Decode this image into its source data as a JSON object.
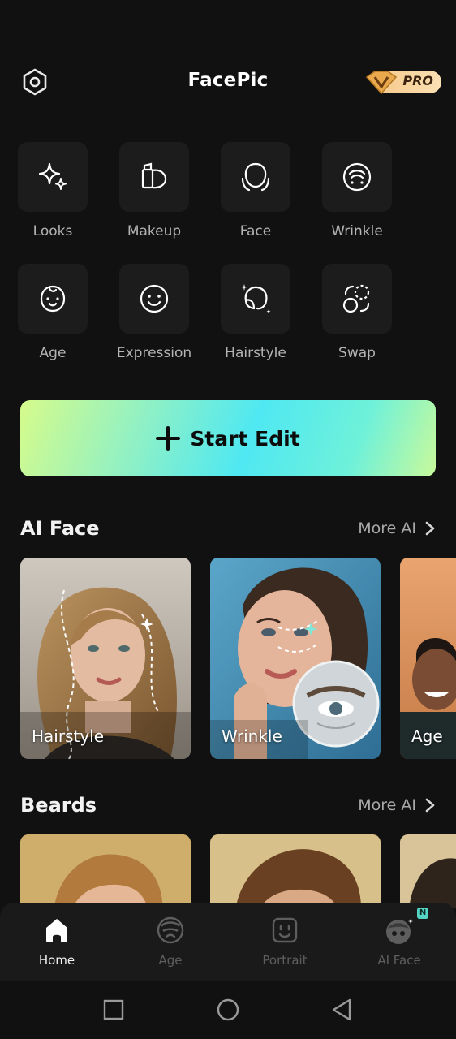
{
  "app": {
    "title": "FacePic",
    "pro_label": "PRO"
  },
  "tools": [
    {
      "label": "Looks",
      "icon": "sparkles-icon"
    },
    {
      "label": "Makeup",
      "icon": "makeup-icon"
    },
    {
      "label": "Face",
      "icon": "face-outline-icon"
    },
    {
      "label": "Wrinkle",
      "icon": "wrinkle-icon"
    },
    {
      "label": "Age",
      "icon": "baby-face-icon"
    },
    {
      "label": "Expression",
      "icon": "smiley-icon"
    },
    {
      "label": "Hairstyle",
      "icon": "hairstyle-icon"
    },
    {
      "label": "Swap",
      "icon": "face-swap-icon"
    }
  ],
  "start_button": {
    "label": "Start Edit"
  },
  "ai_face": {
    "title": "AI Face",
    "more_label": "More AI",
    "cards": [
      {
        "label": "Hairstyle"
      },
      {
        "label": "Wrinkle"
      },
      {
        "label": "Age"
      }
    ]
  },
  "beards": {
    "title": "Beards",
    "more_label": "More AI"
  },
  "tabbar": {
    "items": [
      {
        "label": "Home",
        "active": true
      },
      {
        "label": "Age",
        "active": false
      },
      {
        "label": "Portrait",
        "active": false
      },
      {
        "label": "AI Face",
        "active": false,
        "badge": "N"
      }
    ]
  },
  "colors": {
    "accent_start": "#d6fb8b",
    "accent_mid": "#4fe8f2",
    "background": "#111111",
    "pro_gold": "#f6c98a"
  }
}
